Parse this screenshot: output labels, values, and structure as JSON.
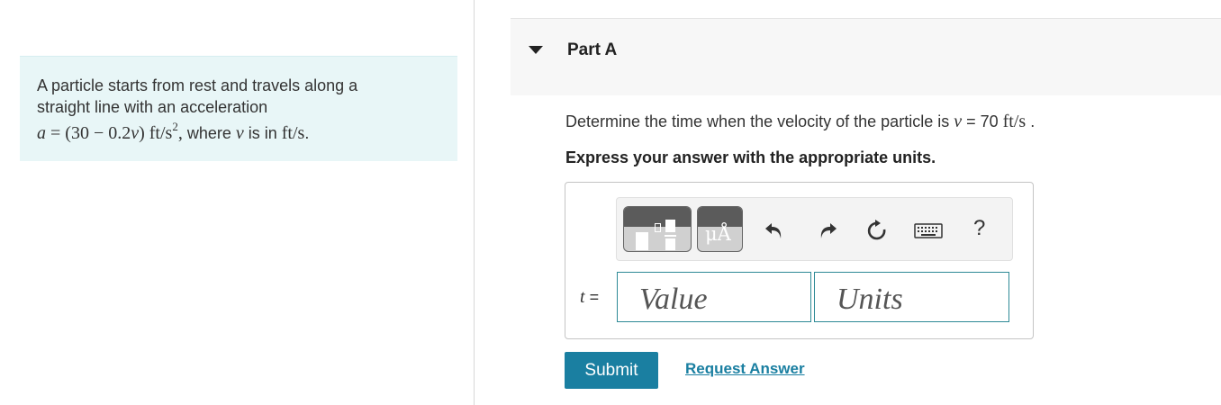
{
  "problem": {
    "line1": "A particle starts from rest and travels along a",
    "line2": "straight line with an acceleration",
    "eq_lhs": "a",
    "eq_mid": " = (30 − 0.2",
    "eq_v": "v",
    "eq_unit": ") ft/s",
    "eq_exp": "2",
    "eq_comma": ",",
    "where_text": " where ",
    "where_v": "v",
    "is_in": " is in ",
    "unit_fts": "ft/s",
    "period": "."
  },
  "part": {
    "title": "Part A",
    "toggle_icon": "triangle-down"
  },
  "question": {
    "prefix": "Determine the time when the velocity of the particle is ",
    "var": "v",
    "equals": " = 70 ",
    "unit": "ft/s",
    "suffix": " ."
  },
  "instruction": "Express your answer with the appropriate units.",
  "toolbar": {
    "template_icon": "fraction-template-icon",
    "units_icon_text": "μÅ",
    "undo_icon": "undo-icon",
    "redo_icon": "redo-icon",
    "reset_icon": "reset-icon",
    "keyboard_icon": "keyboard-icon",
    "help_text": "?"
  },
  "answer": {
    "var_label": "t",
    "equals": " =",
    "value_placeholder": "Value",
    "units_placeholder": "Units"
  },
  "actions": {
    "submit_label": "Submit",
    "request_label": "Request Answer"
  },
  "colors": {
    "accent": "#1a7fa1",
    "problem_bg": "#e8f6f7",
    "input_border": "#2e8a96"
  }
}
